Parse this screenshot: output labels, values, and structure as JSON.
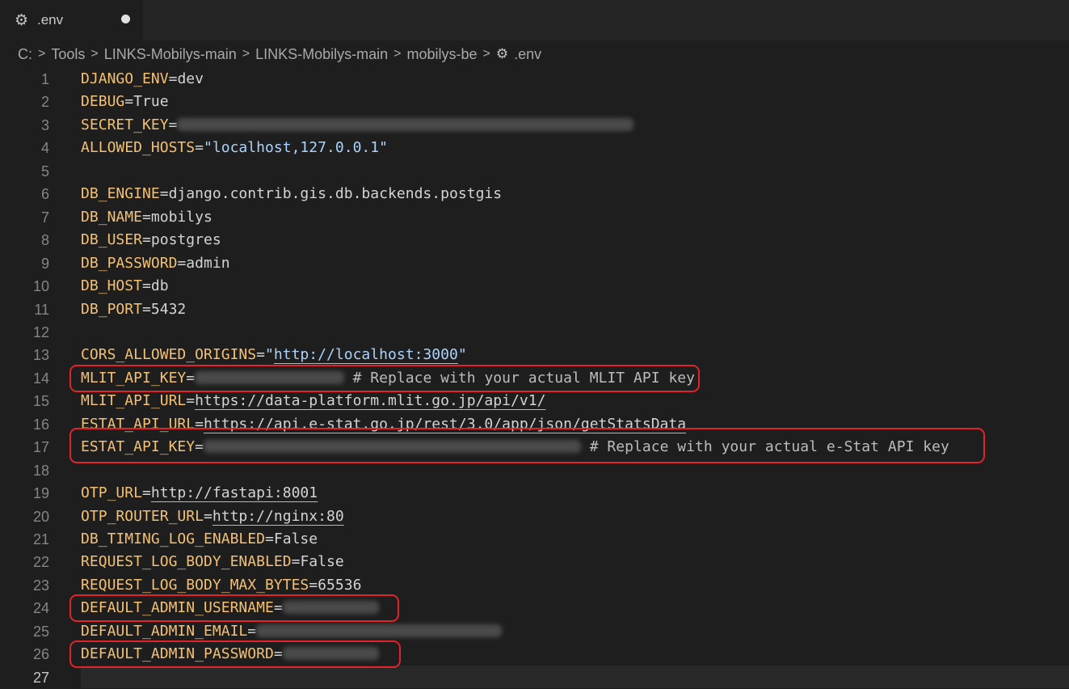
{
  "tab": {
    "filename": ".env",
    "icon": "gear-icon",
    "dirty_indicator": "unsaved-dot"
  },
  "breadcrumb": {
    "items": [
      "C:",
      "Tools",
      "LINKS-Mobilys-main",
      "LINKS-Mobilys-main",
      "mobilys-be"
    ],
    "file": ".env"
  },
  "editor": {
    "lines": [
      {
        "n": "1",
        "key": "DJANGO_ENV",
        "eq": "=",
        "val": "dev"
      },
      {
        "n": "2",
        "key": "DEBUG",
        "eq": "=",
        "val": "True"
      },
      {
        "n": "3",
        "key": "SECRET_KEY",
        "eq": "=",
        "redacted": "xxxxxxxxxxxxxxxxxxxxxxxxxxxxxxxxxxxxxxxxxxxxxxxxxxxx"
      },
      {
        "n": "4",
        "key": "ALLOWED_HOSTS",
        "eq": "=",
        "str": "\"localhost,127.0.0.1\""
      },
      {
        "n": "5"
      },
      {
        "n": "6",
        "key": "DB_ENGINE",
        "eq": "=",
        "val": "django.contrib.gis.db.backends.postgis"
      },
      {
        "n": "7",
        "key": "DB_NAME",
        "eq": "=",
        "val": "mobilys"
      },
      {
        "n": "8",
        "key": "DB_USER",
        "eq": "=",
        "val": "postgres"
      },
      {
        "n": "9",
        "key": "DB_PASSWORD",
        "eq": "=",
        "val": "admin"
      },
      {
        "n": "10",
        "key": "DB_HOST",
        "eq": "=",
        "val": "db"
      },
      {
        "n": "11",
        "key": "DB_PORT",
        "eq": "=",
        "val": "5432"
      },
      {
        "n": "12"
      },
      {
        "n": "13",
        "key": "CORS_ALLOWED_ORIGINS",
        "eq": "=",
        "str_open": "\"",
        "strurl": "http://localhost:3000",
        "str_close": "\""
      },
      {
        "n": "14",
        "key": "MLIT_API_KEY",
        "eq": "=",
        "redacted": "xxxxxxxxxxxxxxxxx",
        "comment": " # Replace with your actual MLIT API key"
      },
      {
        "n": "15",
        "key": "MLIT_API_URL",
        "eq": "=",
        "url": "https://data-platform.mlit.go.jp/api/v1/"
      },
      {
        "n": "16",
        "key": "ESTAT_API_URL",
        "eq": "=",
        "url": "https://api.e-stat.go.jp/rest/3.0/app/json/getStatsData"
      },
      {
        "n": "17",
        "key": "ESTAT_API_KEY",
        "eq": "=",
        "redacted": "xxxxxxxxxxxxxxxxxxxxxxxxxxxxxxxxxxxxxxxxxxx",
        "comment": " # Replace with your actual e-Stat API key"
      },
      {
        "n": "18"
      },
      {
        "n": "19",
        "key": "OTP_URL",
        "eq": "=",
        "url": "http://fastapi:8001"
      },
      {
        "n": "20",
        "key": "OTP_ROUTER_URL",
        "eq": "=",
        "url": "http://nginx:80"
      },
      {
        "n": "21",
        "key": "DB_TIMING_LOG_ENABLED",
        "eq": "=",
        "val": "False"
      },
      {
        "n": "22",
        "key": "REQUEST_LOG_BODY_ENABLED",
        "eq": "=",
        "val": "False"
      },
      {
        "n": "23",
        "key": "REQUEST_LOG_BODY_MAX_BYTES",
        "eq": "=",
        "val": "65536"
      },
      {
        "n": "24",
        "key": "DEFAULT_ADMIN_USERNAME",
        "eq": "=",
        "redacted": "xxxxxxxxxxx"
      },
      {
        "n": "25",
        "key": "DEFAULT_ADMIN_EMAIL",
        "eq": "=",
        "redacted": "xxxxxxxxxxxxxxxxxxxxxxxxxxxx"
      },
      {
        "n": "26",
        "key": "DEFAULT_ADMIN_PASSWORD",
        "eq": "=",
        "redacted": "xxxxxxxxxxx"
      },
      {
        "n": "27"
      }
    ],
    "highlighted_lines": [
      "14",
      "17",
      "24",
      "26"
    ],
    "current_line": "27"
  },
  "colors": {
    "background": "#1e1e1e",
    "key": "#f3c074",
    "string": "#a9d4ff",
    "highlight_box": "#e0242a",
    "line_number": "#858585"
  }
}
